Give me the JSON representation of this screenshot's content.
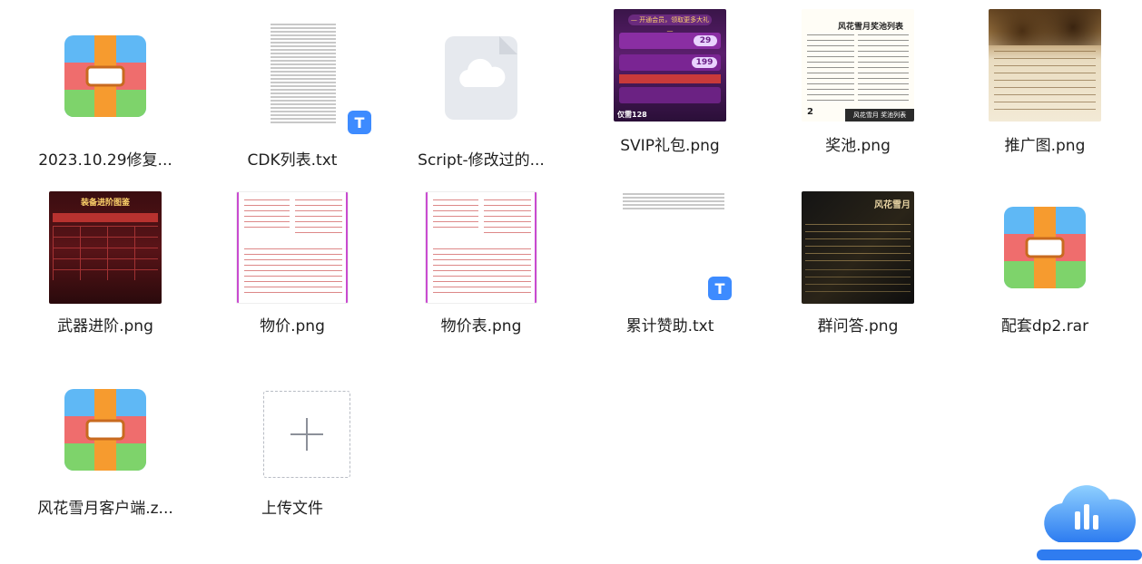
{
  "files": [
    {
      "id": "f1",
      "label": "2023.10.29修复...",
      "kind": "archive"
    },
    {
      "id": "f2",
      "label": "CDK列表.txt",
      "kind": "text-dense"
    },
    {
      "id": "f3",
      "label": "Script-修改过的...",
      "kind": "cloud-file"
    },
    {
      "id": "f4",
      "label": "SVIP礼包.png",
      "kind": "image-svip"
    },
    {
      "id": "f5",
      "label": "奖池.png",
      "kind": "image-pool"
    },
    {
      "id": "f6",
      "label": "推广图.png",
      "kind": "image-promo"
    },
    {
      "id": "f7",
      "label": "武器进阶.png",
      "kind": "image-weapon"
    },
    {
      "id": "f8",
      "label": "物价.png",
      "kind": "image-price"
    },
    {
      "id": "f9",
      "label": "物价表.png",
      "kind": "image-price"
    },
    {
      "id": "f10",
      "label": "累计赞助.txt",
      "kind": "text-sparse"
    },
    {
      "id": "f11",
      "label": "群问答.png",
      "kind": "image-faq"
    },
    {
      "id": "f12",
      "label": "配套dp2.rar",
      "kind": "archive"
    },
    {
      "id": "f13",
      "label": "风花雪月客户端.z...",
      "kind": "archive"
    }
  ],
  "upload": {
    "label": "上传文件"
  },
  "thumbs": {
    "svip": {
      "banner": "— 开通会员，领取更多大礼 —",
      "price_a": "29",
      "price_b": "199",
      "footer": "仅需128"
    },
    "pool": {
      "title": "风花雪月奖池列表",
      "footer": "风花雪月 奖池列表",
      "num": "2"
    },
    "weapon": {
      "title": "装备进阶图鉴"
    },
    "faq": {
      "title": "风花雪月"
    },
    "txt_badge": "T"
  }
}
